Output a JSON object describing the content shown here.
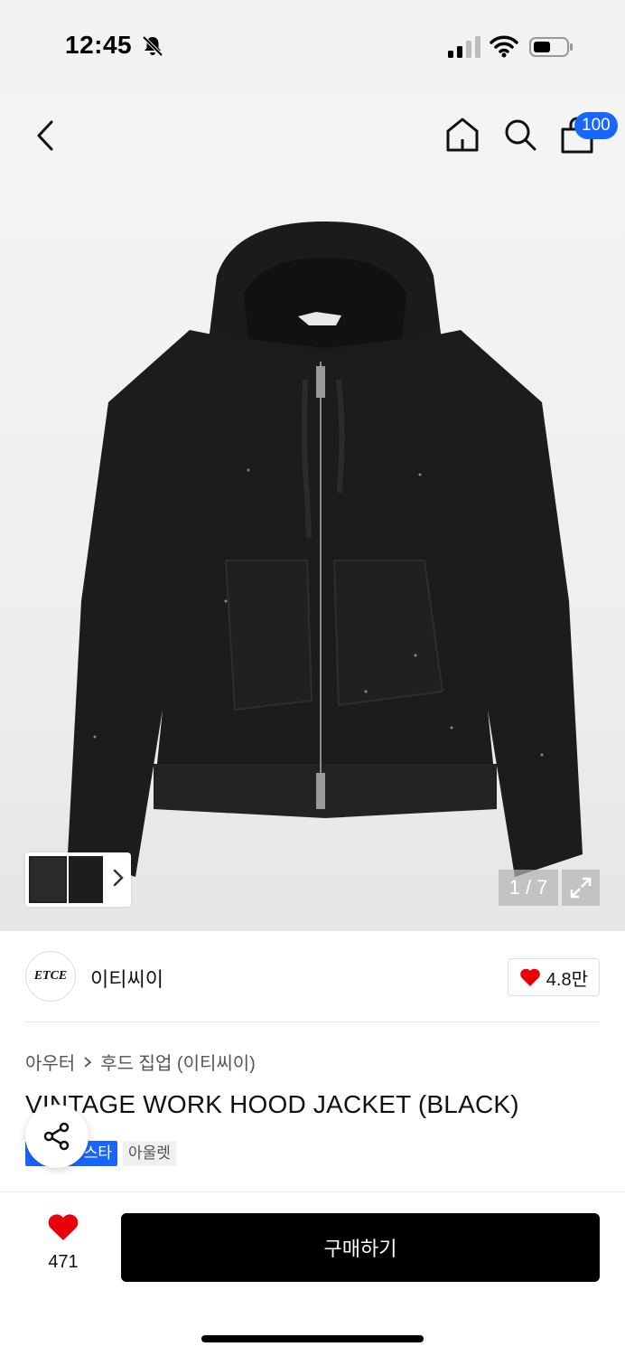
{
  "status": {
    "time": "12:45"
  },
  "nav": {
    "cart_count": "100"
  },
  "gallery": {
    "pager": "1 / 7"
  },
  "brand": {
    "logo_text": "ETCE",
    "name": "이티씨이",
    "likes": "4.8만"
  },
  "breadcrumb": {
    "category": "아우터",
    "subcategory": "후드 집업 (이티씨이)"
  },
  "product": {
    "title": "VINTAGE WORK HOOD JACKET (BLACK)",
    "tags": [
      "스타",
      "아울렛"
    ]
  },
  "bottom": {
    "like_count": "471",
    "buy_label": "구매하기"
  },
  "colors": {
    "accent": "#1966ff",
    "heart": "#e8000b",
    "buy_bg": "#000000"
  }
}
